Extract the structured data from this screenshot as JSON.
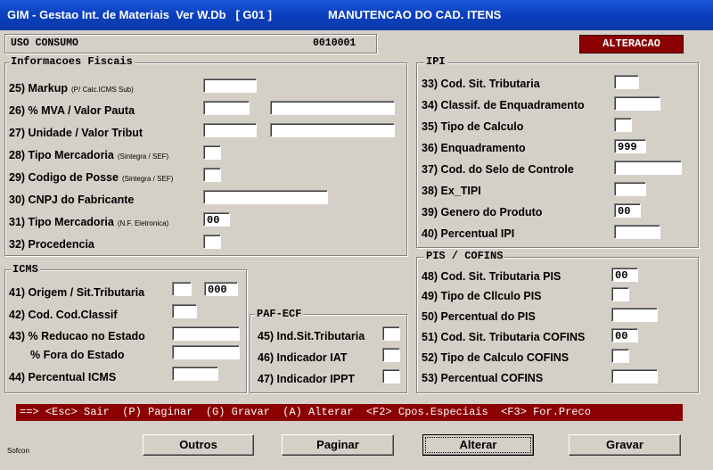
{
  "window": {
    "title_left": "GIM - Gestao Int. de Materiais  Ver W.Db   [ G01 ]",
    "title_right": "MANUTENCAO DO CAD. ITENS"
  },
  "header": {
    "uso_label": "USO CONSUMO",
    "code": "0010001",
    "mode": "ALTERACAO"
  },
  "fiscal": {
    "title": "Informacoes Fiscais",
    "f25": "25)  Markup",
    "f25_note": "(P/ Calc.ICMS Sub)",
    "f26": "26)  % MVA  /  Valor Pauta",
    "f27": "27)  Unidade / Valor Tribut",
    "f28": "28)  Tipo Mercadoria",
    "f28_note": "(Sintegra / SEF)",
    "f29": "29)  Codigo de Posse",
    "f29_note": "(Sintegra / SEF)",
    "f30": "30)  CNPJ do Fabricante",
    "f31": "31)  Tipo Mercadoria",
    "f31_note": "(N.F. Eletronica)",
    "f31_value": "00",
    "f32": "32)  Procedencia"
  },
  "icms": {
    "title": "ICMS",
    "f41": "41)  Origem / Sit.Tributaria",
    "f41_value": "000",
    "f42": "42)  Cod. Cod.Classif",
    "f43": "43)  % Reducao no Estado",
    "f43b": "% Fora do Estado",
    "f44": "44)  Percentual  ICMS"
  },
  "paf": {
    "title": "PAF-ECF",
    "f45": "45) Ind.Sit.Tributaria",
    "f46": "46)  Indicador  IAT",
    "f47": "47)  Indicador  IPPT"
  },
  "ipi": {
    "title": "IPI",
    "f33": "33)  Cod. Sit. Tributaria",
    "f34": "34)  Classif. de Enquadramento",
    "f35": "35)  Tipo de Calculo",
    "f36": "36)  Enquadramento",
    "f36_value": "999",
    "f37": "37)  Cod. do Selo de Controle",
    "f38": "38)  Ex_TIPI",
    "f39": "39)  Genero do Produto",
    "f39_value": "00",
    "f40": "40)  Percentual IPI"
  },
  "pis": {
    "title": "PIS / COFINS",
    "f48": "48)  Cod. Sit. Tributaria PIS",
    "f48_value": "00",
    "f49": "49)  Tipo de Cllculo PIS",
    "f50": "50)  Percentual do PIS",
    "f51": "51)  Cod. Sit. Tributaria COFINS",
    "f51_value": "00",
    "f52": "52)  Tipo de Calculo COFINS",
    "f53": "53)  Percentual  COFINS"
  },
  "status_bar": "==> <Esc> Sair  (P) Paginar  (G) Gravar  (A) Alterar  <F2> Cpos.Especiais  <F3> For.Preco",
  "buttons": {
    "outros": "Outros",
    "paginar": "Paginar",
    "alterar": "Alterar",
    "gravar": "Gravar"
  },
  "footer": "Sofcon",
  "colors": {
    "titlebar": "#0a3fbd",
    "accent_red": "#8b0000",
    "background": "#d4d0c8"
  }
}
